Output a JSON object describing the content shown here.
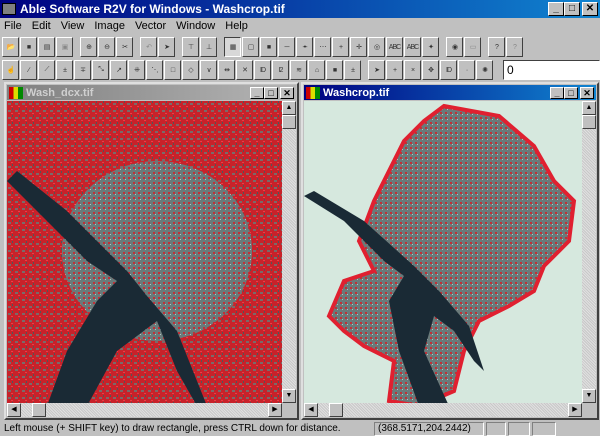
{
  "app": {
    "title": "Able Software R2V for Windows - Washcrop.tif",
    "min": "_",
    "max": "□",
    "close": "✕"
  },
  "menu": [
    "File",
    "Edit",
    "View",
    "Image",
    "Vector",
    "Window",
    "Help"
  ],
  "toolbar1": [
    {
      "icon": "open-folder-icon",
      "g": "📂"
    },
    {
      "icon": "save-icon",
      "g": "■"
    },
    {
      "icon": "open-project-icon",
      "g": "▤"
    },
    {
      "icon": "save-project-icon",
      "g": "▣",
      "dis": 1
    },
    {
      "sep": 1
    },
    {
      "icon": "zoom-in-icon",
      "g": "⊕"
    },
    {
      "icon": "zoom-out-icon",
      "g": "⊖"
    },
    {
      "icon": "pan-icon",
      "g": "✂"
    },
    {
      "sep": 1
    },
    {
      "icon": "undo-icon",
      "g": "↶",
      "dis": 1
    },
    {
      "icon": "select-arrow-icon",
      "g": "➤"
    },
    {
      "sep": 1
    },
    {
      "icon": "tile-horizontal-icon",
      "g": "⊤"
    },
    {
      "icon": "tile-vertical-icon",
      "g": "⊥"
    },
    {
      "sep": 1
    },
    {
      "icon": "show-raster-icon",
      "g": "▦",
      "on": 1
    },
    {
      "icon": "show-frame-icon",
      "g": "▢"
    },
    {
      "icon": "show-area-icon",
      "g": "■"
    },
    {
      "icon": "line-icon",
      "g": "─"
    },
    {
      "icon": "node-line-icon",
      "g": "-•-"
    },
    {
      "icon": "network-icon",
      "g": "⋯"
    },
    {
      "icon": "point-icon",
      "g": "+"
    },
    {
      "icon": "point-id-icon",
      "g": "✛"
    },
    {
      "icon": "circle-icon",
      "g": "◎"
    },
    {
      "icon": "text-abc-icon",
      "g": "ABC"
    },
    {
      "icon": "text-abc2-icon",
      "g": "ABC"
    },
    {
      "icon": "control-point-icon",
      "g": "✦"
    },
    {
      "sep": 1
    },
    {
      "icon": "identify-pointer-icon",
      "g": "◉"
    },
    {
      "icon": "edit-pointer-icon",
      "g": "▭",
      "dis": 1
    },
    {
      "sep": 1
    },
    {
      "icon": "help-icon",
      "g": "?"
    },
    {
      "icon": "context-help-icon",
      "g": "?",
      "dis": 1
    }
  ],
  "toolbar2": [
    {
      "icon": "hand-select-icon",
      "g": "☝"
    },
    {
      "icon": "draw-line-icon",
      "g": "∕"
    },
    {
      "icon": "polyline-icon",
      "g": "⟋"
    },
    {
      "icon": "insert-node-icon",
      "g": "±"
    },
    {
      "icon": "delete-node-icon",
      "g": "∓"
    },
    {
      "icon": "move-node-icon",
      "g": "⤡"
    },
    {
      "icon": "extend-line-icon",
      "g": "↗"
    },
    {
      "icon": "split-icon",
      "g": "⁜"
    },
    {
      "icon": "join-icon",
      "g": "⋱"
    },
    {
      "icon": "rectangle-icon",
      "g": "□"
    },
    {
      "icon": "rotate-icon",
      "g": "◇"
    },
    {
      "icon": "angle-icon",
      "g": "∨"
    },
    {
      "icon": "break-line-icon",
      "g": "⇹"
    },
    {
      "icon": "delete-line-icon",
      "g": "✕"
    },
    {
      "icon": "id-icon",
      "g": "ID"
    },
    {
      "icon": "id-increment-icon",
      "g": "I2"
    },
    {
      "icon": "contour-icon",
      "g": "≋"
    },
    {
      "icon": "polygon-icon",
      "g": "⌂"
    },
    {
      "icon": "fill-area-icon",
      "g": "■"
    },
    {
      "icon": "label-icon",
      "g": "±"
    },
    {
      "sep": 1
    },
    {
      "icon": "point-select-icon",
      "g": "➤"
    },
    {
      "icon": "add-point-icon",
      "g": "+"
    },
    {
      "icon": "delete-point-icon",
      "g": "×"
    },
    {
      "icon": "move-point-icon",
      "g": "✥"
    },
    {
      "icon": "point-id-icon",
      "g": "ID"
    },
    {
      "icon": "point-snap-icon",
      "g": "·"
    },
    {
      "icon": "point-light-icon",
      "g": "✺"
    }
  ],
  "toolbar_input": "0",
  "windows": [
    {
      "title": "Wash_dcx.tif",
      "active": false
    },
    {
      "title": "Washcrop.tif",
      "active": true
    }
  ],
  "status": {
    "message": "Left mouse (+ SHIFT key) to draw rectangle, press CTRL down for distance.",
    "coords": "(368.5171,204.2442)"
  }
}
